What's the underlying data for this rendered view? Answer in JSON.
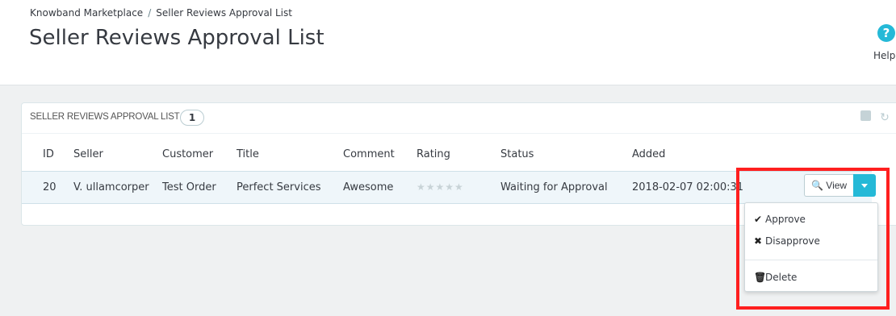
{
  "breadcrumb": {
    "parent": "Knowband Marketplace",
    "separator": "/",
    "current": "Seller Reviews Approval List"
  },
  "page_title": "Seller Reviews Approval List",
  "help": {
    "label": "Help",
    "icon": "help-circle-icon",
    "glyph": "?"
  },
  "panel": {
    "title": "SELLER REVIEWS APPROVAL LIST",
    "count": "1",
    "tools": [
      "export-icon",
      "refresh-icon"
    ],
    "refresh_glyph": "↻"
  },
  "table": {
    "headers": {
      "id": "ID",
      "seller": "Seller",
      "customer": "Customer",
      "title": "Title",
      "comment": "Comment",
      "rating": "Rating",
      "status": "Status",
      "added": "Added"
    },
    "rows": [
      {
        "id": "20",
        "seller": "V. ullamcorper",
        "customer": "Test Order",
        "title": "Perfect Services",
        "comment": "Awesome",
        "rating_stars": "★★★★★",
        "rating_value": 0,
        "status": "Waiting for Approval",
        "added": "2018-02-07 02:00:31"
      }
    ]
  },
  "actions": {
    "view_label": "View",
    "view_icon": "zoom-in-icon",
    "view_glyph": "🔍",
    "caret_icon": "caret-down-icon",
    "menu": {
      "approve": {
        "label": "Approve",
        "icon": "check-icon",
        "glyph": "✔"
      },
      "disapprove": {
        "label": "Disapprove",
        "icon": "close-icon",
        "glyph": "✖"
      },
      "delete": {
        "label": "Delete",
        "icon": "trash-icon",
        "glyph": "🗑"
      }
    }
  },
  "colors": {
    "accent": "#25b9d7",
    "highlight": "#ff1f1f",
    "row_bg": "#eff6fa",
    "text": "#363a41"
  }
}
